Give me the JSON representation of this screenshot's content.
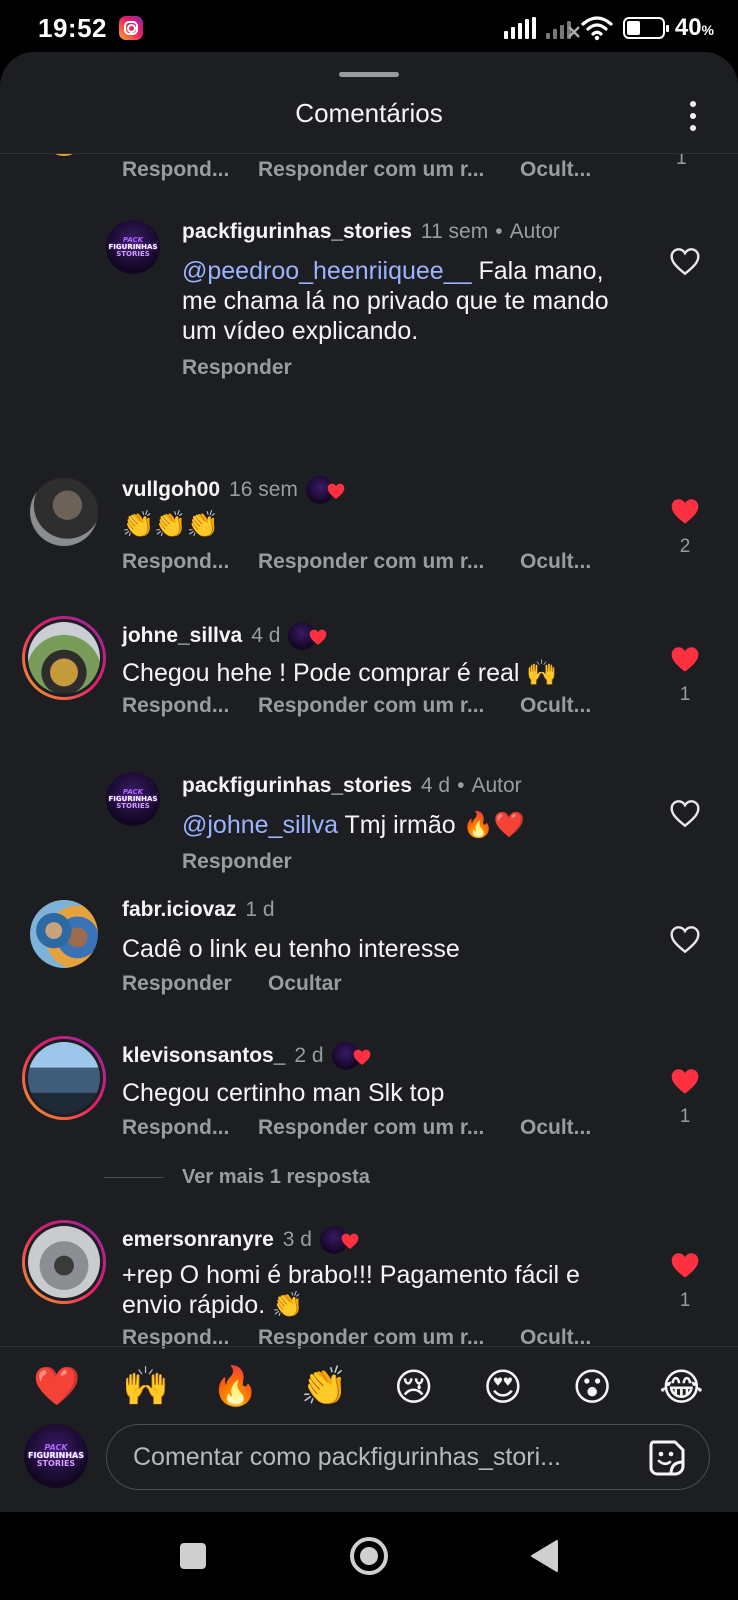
{
  "status_bar": {
    "time": "19:52",
    "battery_percent": "40",
    "battery_unit": "%",
    "battery_level": 0.4,
    "icons": [
      "instagram-icon",
      "signal-icon",
      "signal-no-service-icon",
      "wifi-icon",
      "battery-icon"
    ]
  },
  "sheet": {
    "title": "Comentários",
    "menu_icon": "more-vertical-icon"
  },
  "comments": [
    {
      "id": "partial",
      "actions": [
        "Respond...",
        "Responder com um r...",
        "Ocult..."
      ],
      "like_count": "1"
    },
    {
      "id": "reply-1",
      "username": "packfigurinhas_stories",
      "time": "11 sem",
      "dot": "•",
      "author_label": "Autor",
      "mention": "@peedroo_heenriiquee__",
      "text": " Fala mano, me chama lá no privado que te mando um vídeo explicando.",
      "actions": [
        "Responder"
      ],
      "liked": false
    },
    {
      "id": "c-vullgoh",
      "username": "vullgoh00",
      "time": "16 sem",
      "text": "👏👏👏",
      "actions": [
        "Respond...",
        "Responder com um r...",
        "Ocult..."
      ],
      "liked": true,
      "like_count": "2"
    },
    {
      "id": "c-johne",
      "username": "johne_sillva",
      "time": "4 d",
      "text": "Chegou hehe ! Pode comprar é real 🙌",
      "actions": [
        "Respond...",
        "Responder com um r...",
        "Ocult..."
      ],
      "liked": true,
      "like_count": "1"
    },
    {
      "id": "reply-2",
      "username": "packfigurinhas_stories",
      "time": "4 d",
      "dot": "•",
      "author_label": "Autor",
      "mention": "@johne_sillva",
      "text": " Tmj irmão 🔥❤️",
      "actions": [
        "Responder"
      ],
      "liked": false
    },
    {
      "id": "c-fabr",
      "username": "fabr.iciovaz",
      "time": "1 d",
      "text": "Cadê o link eu tenho interesse",
      "actions": [
        "Responder",
        "Ocultar"
      ],
      "liked": false
    },
    {
      "id": "c-klevison",
      "username": "klevisonsantos_",
      "time": "2 d",
      "text": "Chegou certinho man Slk top",
      "actions": [
        "Respond...",
        "Responder com um r...",
        "Ocult..."
      ],
      "liked": true,
      "like_count": "1",
      "more_replies": "Ver mais 1 resposta"
    },
    {
      "id": "c-emerson",
      "username": "emersonranyre",
      "time": "3 d",
      "text": "+rep O homi é brabo!!! Pagamento fácil e envio rápido. 👏",
      "actions": [
        "Respond...",
        "Responder com um r...",
        "Ocult..."
      ],
      "liked": true,
      "like_count": "1"
    }
  ],
  "logo": {
    "line1": "PACK",
    "line2": "FIGURINHAS",
    "line3": "STORIES"
  },
  "reactions": [
    "❤️",
    "🙌",
    "🔥",
    "👏",
    "😢",
    "😍",
    "😮",
    "😂"
  ],
  "composer": {
    "placeholder": "Comentar como packfigurinhas_stori...",
    "sticker_icon": "sticker-icon"
  },
  "nav": [
    "recents-square-icon",
    "home-circle-icon",
    "back-triangle-icon"
  ],
  "colors": {
    "background": "#1c1e22",
    "like_red": "#ff3040",
    "mention_blue": "#9cb4ff",
    "muted_text": "#9a9ca0"
  }
}
